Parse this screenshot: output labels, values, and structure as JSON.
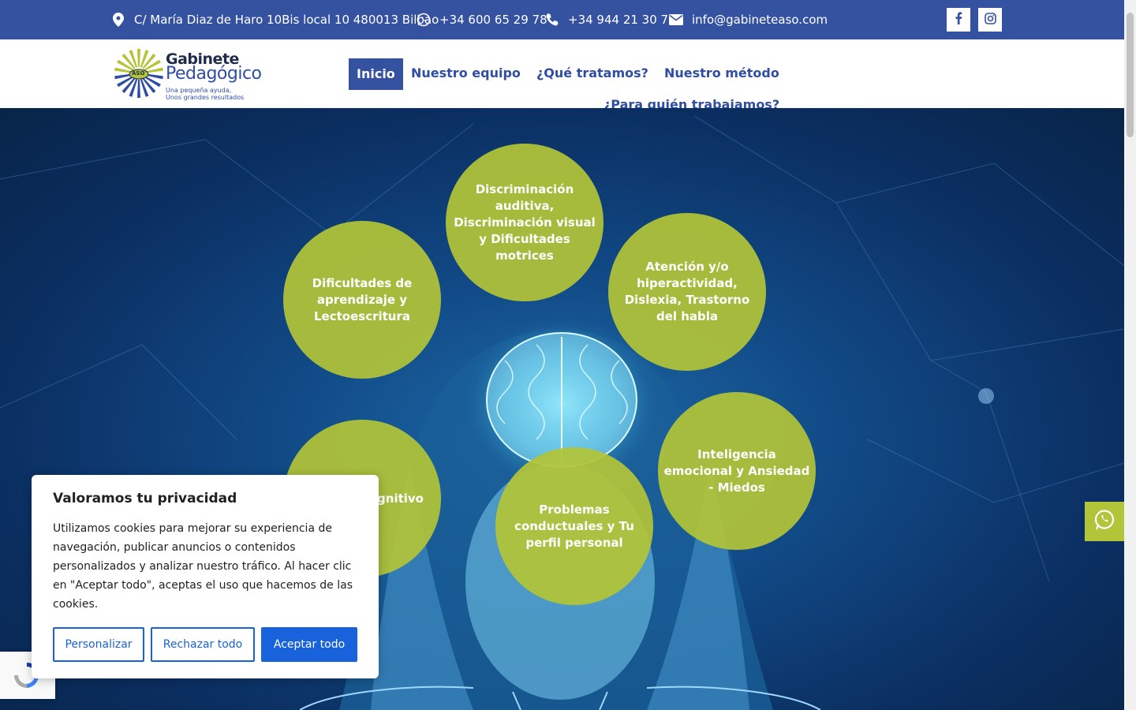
{
  "topbar": {
    "address": "C/ María Diaz de Haro 10Bis local 10 480013 Bilbao",
    "whatsapp": "+34 600 65 29 78",
    "phone": "+34 944 21 30 73",
    "email": "info@gabineteaso.com",
    "social_icons": [
      "facebook-icon",
      "instagram-icon"
    ]
  },
  "logo": {
    "title": "Gabinete",
    "subtitle": "Pedagógico",
    "badge": "ASO",
    "tagline_1": "Una pequeña ayuda,",
    "tagline_2": "Unos grandes resultados"
  },
  "nav": {
    "items": [
      "Inicio",
      "Nuestro equipo",
      "¿Qué tratamos?",
      "Nuestro método",
      "¿Para quién trabajamos?"
    ],
    "active": "Inicio"
  },
  "hero": {
    "circles": [
      "Discriminación auditiva, Discriminación visual y Dificultades motrices",
      "Dificultades de aprendizaje y Lectoescritura",
      "Atención y/o hiperactividad, Dislexia, Trastorno del habla",
      "Inteligencia emocional y Ansiedad - Miedos",
      "Problemas conductuales y Tu perfil personal",
      "Desarrollo cognitivo"
    ]
  },
  "cookie": {
    "title": "Valoramos tu privacidad",
    "text": "Utilizamos cookies para mejorar su experiencia de navegación, publicar anuncios o contenidos personalizados y analizar nuestro tráfico. Al hacer clic en \"Aceptar todo\", aceptas el uso que hacemos de las cookies.",
    "customize": "Personalizar",
    "reject": "Rechazar todo",
    "accept": "Aceptar todo"
  },
  "colors": {
    "brand_blue": "#3552a1",
    "accent_green": "#b2c438",
    "cookie_blue": "#1863dc"
  }
}
